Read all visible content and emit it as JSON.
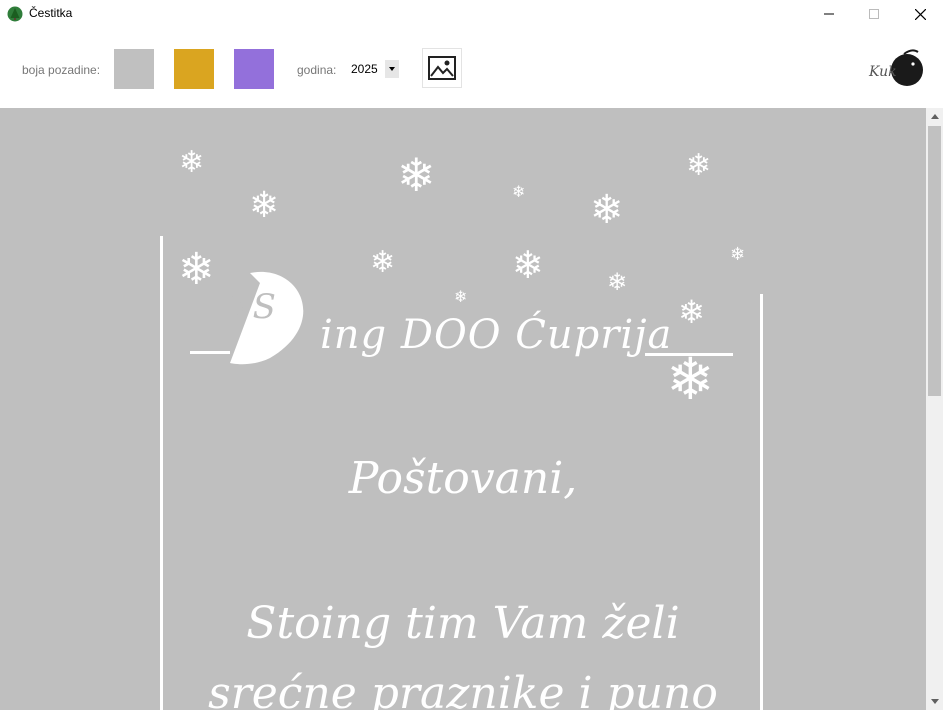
{
  "window": {
    "title": "Čestitka",
    "controls": {
      "minimize": "minimize",
      "maximize": "maximize",
      "close": "close"
    }
  },
  "toolbar": {
    "background_label": "boja pozadine:",
    "swatches": [
      {
        "name": "gray",
        "color": "#c0c0c0"
      },
      {
        "name": "gold",
        "color": "#daa520"
      },
      {
        "name": "purple",
        "color": "#9370db"
      }
    ],
    "year_label": "godina:",
    "year_value": "2025",
    "image_button_icon": "image-icon",
    "logo_text": "Kuk"
  },
  "card": {
    "background": "#bfbfbf",
    "logo_letters": "TS",
    "company": "ing DOO Ćuprija",
    "greeting": "Poštovani,",
    "message_line1": "Stoing tim Vam želi",
    "message_line2": "srećne praznike i puno",
    "decoration_icon": "snowflake-icon"
  }
}
